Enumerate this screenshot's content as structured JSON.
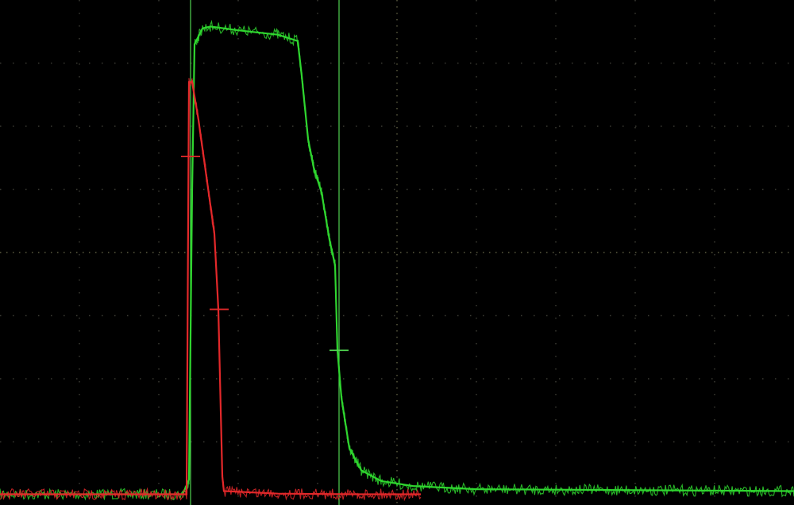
{
  "chart_data": {
    "type": "line",
    "title": "",
    "xlabel": "",
    "ylabel": "",
    "grid": true,
    "xlim": [
      0,
      10
    ],
    "ylim": [
      -4,
      4
    ],
    "x_divisions": 10,
    "y_divisions": 8,
    "background": "#000000",
    "grid_color": "#3a3a32",
    "series": [
      {
        "color": "#2fd62f",
        "points": [
          [
            0,
            -3.83
          ],
          [
            2.3,
            -3.83
          ],
          [
            2.38,
            -3.6
          ],
          [
            2.42,
            1.0
          ],
          [
            2.45,
            3.3
          ],
          [
            2.55,
            3.55
          ],
          [
            2.65,
            3.58
          ],
          [
            3.0,
            3.52
          ],
          [
            3.5,
            3.45
          ],
          [
            3.75,
            3.35
          ],
          [
            3.8,
            2.8
          ],
          [
            3.88,
            1.8
          ],
          [
            3.95,
            1.35
          ],
          [
            4.05,
            0.95
          ],
          [
            4.15,
            0.2
          ],
          [
            4.22,
            -0.2
          ],
          [
            4.25,
            -1.55
          ],
          [
            4.3,
            -2.3
          ],
          [
            4.4,
            -3.1
          ],
          [
            4.55,
            -3.45
          ],
          [
            4.8,
            -3.62
          ],
          [
            5.2,
            -3.7
          ],
          [
            6.0,
            -3.75
          ],
          [
            10,
            -3.78
          ]
        ]
      },
      {
        "color": "#e3282a",
        "points": [
          [
            0,
            -3.83
          ],
          [
            2.35,
            -3.83
          ],
          [
            2.38,
            2.7
          ],
          [
            2.42,
            2.7
          ],
          [
            2.5,
            2.1
          ],
          [
            2.6,
            1.2
          ],
          [
            2.7,
            0.3
          ],
          [
            2.75,
            -0.9
          ],
          [
            2.78,
            -2.5
          ],
          [
            2.8,
            -3.55
          ],
          [
            2.82,
            -3.78
          ],
          [
            3.5,
            -3.82
          ],
          [
            4.5,
            -3.83
          ],
          [
            5.3,
            -3.83
          ]
        ]
      }
    ],
    "cursors": [
      2.4,
      4.27
    ],
    "cursor_color": "#4fd24f",
    "markers": [
      {
        "x": 2.4,
        "y": 1.52,
        "color": "#e3282a"
      },
      {
        "x": 2.76,
        "y": -0.9,
        "color": "#e3282a"
      },
      {
        "x": 4.27,
        "y": -1.55,
        "color": "#4fd24f"
      }
    ]
  }
}
